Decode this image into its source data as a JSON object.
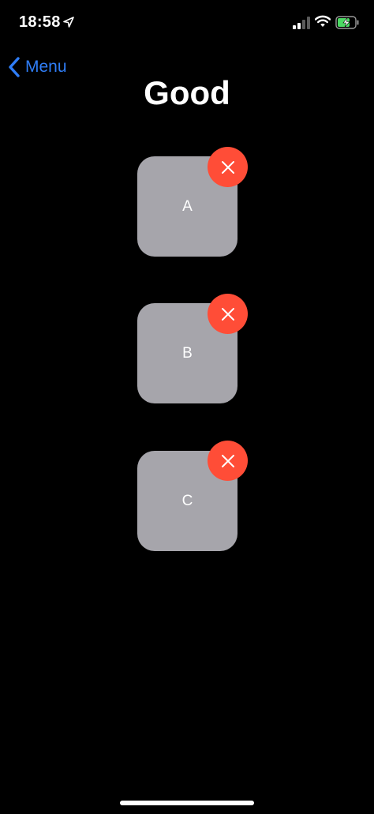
{
  "status_bar": {
    "time": "18:58",
    "icons": [
      "location-arrow-icon",
      "cellular-signal-icon",
      "wifi-icon",
      "battery-charging-icon"
    ]
  },
  "nav": {
    "back_label": "Menu",
    "back_icon": "chevron-left-icon"
  },
  "page": {
    "title": "Good"
  },
  "tiles": [
    {
      "label": "A",
      "delete_icon": "close-icon"
    },
    {
      "label": "B",
      "delete_icon": "close-icon"
    },
    {
      "label": "C",
      "delete_icon": "close-icon"
    }
  ],
  "colors": {
    "background": "#000000",
    "accent_blue": "#2f7df6",
    "tile_gray": "#a6a5ab",
    "delete_red": "#ff4d37",
    "battery_green": "#4cd964"
  }
}
